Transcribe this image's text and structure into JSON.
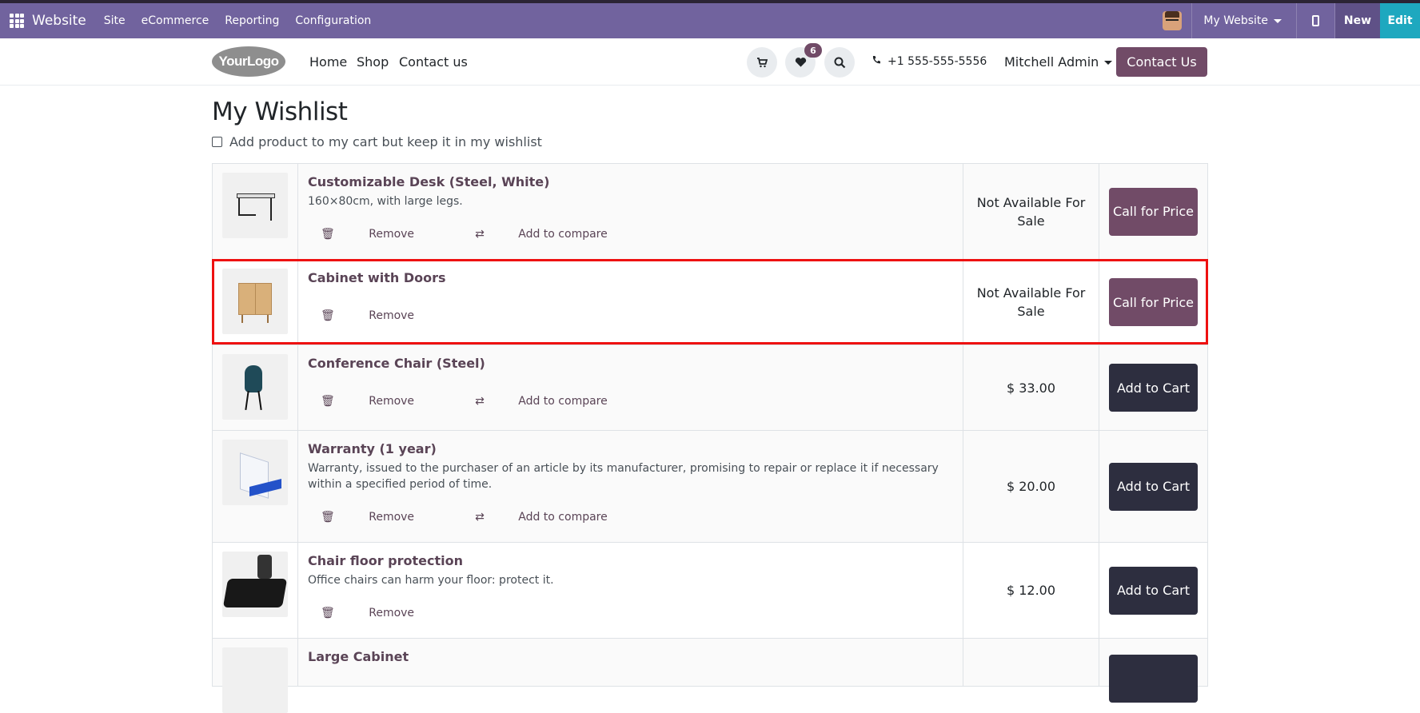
{
  "odoo_bar": {
    "brand": "Website",
    "menus": [
      "Site",
      "eCommerce",
      "Reporting",
      "Configuration"
    ],
    "site_switch": "My Website",
    "new_label": "New",
    "edit_label": "Edit"
  },
  "header": {
    "logo_text": "YourLogo",
    "nav": [
      "Home",
      "Shop",
      "Contact us"
    ],
    "wishlist_count": "6",
    "phone": "+1 555-555-5556",
    "user": "Mitchell Admin",
    "contact_button": "Contact Us"
  },
  "page": {
    "title": "My Wishlist",
    "keep_in_wishlist_label": "Add product to my cart but keep it in my wishlist"
  },
  "labels": {
    "remove": "Remove",
    "compare": "Add to compare"
  },
  "products": [
    {
      "name": "Customizable Desk (Steel, White)",
      "description": "160×80cm, with large legs.",
      "price": "Not Available For Sale",
      "action": "Call for Price",
      "compare": true
    },
    {
      "name": "Cabinet with Doors",
      "description": "",
      "price": "Not Available For Sale",
      "action": "Call for Price",
      "compare": false
    },
    {
      "name": "Conference Chair (Steel)",
      "description": "",
      "price": "$ 33.00",
      "action": "Add to Cart",
      "compare": true
    },
    {
      "name": "Warranty (1 year)",
      "description": "Warranty, issued to the purchaser of an article by its manufacturer, promising to repair or replace it if necessary within a specified period of time.",
      "price": "$ 20.00",
      "action": "Add to Cart",
      "compare": true
    },
    {
      "name": "Chair floor protection",
      "description": "Office chairs can harm your floor: protect it.",
      "price": "$ 12.00",
      "action": "Add to Cart",
      "compare": false
    },
    {
      "name": "Large Cabinet",
      "description": "",
      "price": "",
      "action": "",
      "compare": false
    }
  ],
  "colors": {
    "odoo_purple": "#71639e",
    "brand": "#714b67",
    "cart_button": "#2d2e3f",
    "edit_teal": "#1ea8bf",
    "highlight": "#ee1111"
  }
}
